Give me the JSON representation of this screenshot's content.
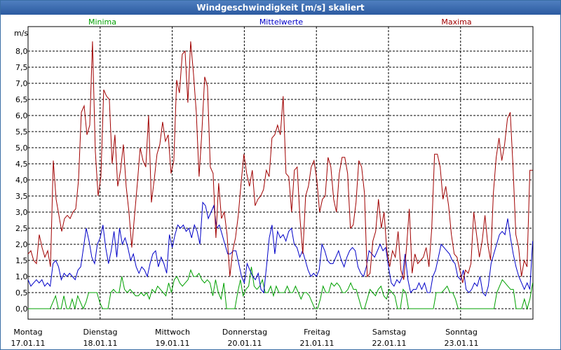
{
  "window": {
    "title": "Windgeschwindigkeit [m/s] skaliert"
  },
  "chart_data": {
    "type": "line",
    "title": "Windgeschwindigkeit [m/s] skaliert",
    "ylabel": "m/s",
    "ylim": [
      0,
      8.6
    ],
    "y_ticks": [
      "0,0",
      "0,5",
      "1,0",
      "1,5",
      "2,0",
      "2,5",
      "3,0",
      "3,5",
      "4,0",
      "4,5",
      "5,0",
      "5,5",
      "6,0",
      "6,5",
      "7,0",
      "7,5",
      "8,0"
    ],
    "y_tick_values": [
      0,
      0.5,
      1,
      1.5,
      2,
      2.5,
      3,
      3.5,
      4,
      4.5,
      5,
      5.5,
      6,
      6.5,
      7,
      7.5,
      8
    ],
    "xlim": [
      0,
      7
    ],
    "x_labels": [
      {
        "day": "Montag",
        "date": "17.01.11",
        "x": 0
      },
      {
        "day": "Dienstag",
        "date": "18.01.11",
        "x": 1
      },
      {
        "day": "Mittwoch",
        "date": "19.01.11",
        "x": 2
      },
      {
        "day": "Donnerstag",
        "date": "20.01.11",
        "x": 3
      },
      {
        "day": "Freitag",
        "date": "21.01.11",
        "x": 4
      },
      {
        "day": "Samstag",
        "date": "22.01.11",
        "x": 5
      },
      {
        "day": "Sonntag",
        "date": "23.01.11",
        "x": 6
      }
    ],
    "grid": true,
    "legend_position": "top",
    "series": [
      {
        "name": "Minima",
        "color": "#00a000",
        "values": [
          0,
          0,
          0,
          0,
          0,
          0,
          0,
          0,
          0,
          0.2,
          0.4,
          0,
          0,
          0.4,
          0,
          0,
          0.3,
          0,
          0.4,
          0.2,
          0,
          0.2,
          0.5,
          0.5,
          0.5,
          0.5,
          0.2,
          0,
          0,
          0,
          0.5,
          0.6,
          0.5,
          0.5,
          1.0,
          0.6,
          0.5,
          0.6,
          0.5,
          0.4,
          0.4,
          0.5,
          0.4,
          0.5,
          0.3,
          0.6,
          0.5,
          0.7,
          0.6,
          0.5,
          0.4,
          0.8,
          0.5,
          0.9,
          1.0,
          0.8,
          0.7,
          0.8,
          0.9,
          1.2,
          1.0,
          1.0,
          1.1,
          0.9,
          0.8,
          0.9,
          0.8,
          0.4,
          0.9,
          0.5,
          0.3,
          0.8,
          0,
          0,
          0,
          0,
          0.5,
          0.9,
          0.4,
          0.6,
          0.7,
          1.3,
          0.7,
          0.6,
          0.7,
          0.9,
          0.5,
          0.5,
          0.7,
          0.4,
          0.7,
          0.5,
          0.5,
          0.5,
          0.7,
          0.5,
          0.5,
          0.7,
          0.5,
          0.3,
          0.5,
          0.5,
          0.4,
          0.2,
          0,
          0,
          0.3,
          0.7,
          0.5,
          0.5,
          0.8,
          0.7,
          0.8,
          0.7,
          0.5,
          0.5,
          0.6,
          0.8,
          0.6,
          0.6,
          0.3,
          0,
          0,
          0.3,
          0.6,
          0.5,
          0.4,
          0.6,
          0.7,
          0.4,
          0.3,
          0.6,
          0.5,
          0.4,
          0,
          0,
          0.6,
          0.5,
          0,
          0,
          0,
          0,
          0,
          0,
          0,
          0,
          0,
          0,
          0.5,
          0.5,
          0.5,
          0.6,
          0.7,
          0.5,
          0.5,
          0.3,
          0,
          0,
          0,
          0,
          0,
          0,
          0,
          0,
          0,
          0,
          0,
          0,
          0,
          0,
          0.5,
          0.7,
          0.9,
          0.8,
          0.7,
          0.6,
          0.6,
          0,
          0,
          0,
          0.3,
          0,
          0.3,
          0.8
        ],
        "x_start": 0.0,
        "x_end": 7.0
      },
      {
        "name": "Mittelwerte",
        "color": "#0000c8",
        "values": [
          0.9,
          0.7,
          0.8,
          0.9,
          0.8,
          0.9,
          0.7,
          0.8,
          0.7,
          1.4,
          1.5,
          1.3,
          0.9,
          1.1,
          1.0,
          1.1,
          1.0,
          0.9,
          1.2,
          1.3,
          1.9,
          2.5,
          2.1,
          1.6,
          1.4,
          2.0,
          2.2,
          2.6,
          1.9,
          1.4,
          1.8,
          2.4,
          1.6,
          2.5,
          2.0,
          2.2,
          1.9,
          1.5,
          1.7,
          1.3,
          1.1,
          1.3,
          1.2,
          1.0,
          1.4,
          1.7,
          1.8,
          1.3,
          1.6,
          1.4,
          1.1,
          2.3,
          1.9,
          2.3,
          2.6,
          2.5,
          2.6,
          2.4,
          2.5,
          2.2,
          2.6,
          2.4,
          2.0,
          3.3,
          3.2,
          2.8,
          3.0,
          3.2,
          2.5,
          2.6,
          2.3,
          2.0,
          1.7,
          1.7,
          1.8,
          1.8,
          1.4,
          1.0,
          0.8,
          1.4,
          1.2,
          1.0,
          0.9,
          1.1,
          0.6,
          0.5,
          1.3,
          2.2,
          2.6,
          1.7,
          2.4,
          2.2,
          2.3,
          2.1,
          2.4,
          2.5,
          2.0,
          1.9,
          1.6,
          1.8,
          1.5,
          1.2,
          1.0,
          1.1,
          1.0,
          1.2,
          2.0,
          1.8,
          1.5,
          1.4,
          1.4,
          1.6,
          1.8,
          1.5,
          1.3,
          1.6,
          1.8,
          1.9,
          1.8,
          1.3,
          1.1,
          1.0,
          1.3,
          1.8,
          1.7,
          1.6,
          1.8,
          2.0,
          1.8,
          1.9,
          1.3,
          0.8,
          0.7,
          0.9,
          0.8,
          1.0,
          1.7,
          0.9,
          0.5,
          0.6,
          0.6,
          0.8,
          0.6,
          0.8,
          0.5,
          0.5,
          1.0,
          1.2,
          1.6,
          2.0,
          1.9,
          1.8,
          1.7,
          1.5,
          1.4,
          1.0,
          0.9,
          1.2,
          0.6,
          0.5,
          0.6,
          0.8,
          0.7,
          1.0,
          0.5,
          0.4,
          0.7,
          1.4,
          1.7,
          2.0,
          2.3,
          2.4,
          2.3,
          2.8,
          2.2,
          1.7,
          1.3,
          1.0,
          0.8,
          0.6,
          0.8,
          0.6,
          2.1
        ],
        "x_start": 0.0,
        "x_end": 7.0
      },
      {
        "name": "Maxima",
        "color": "#a00000",
        "values": [
          1.7,
          1.8,
          1.5,
          1.4,
          2.3,
          1.9,
          1.6,
          1.8,
          1.3,
          4.6,
          3.4,
          2.9,
          2.4,
          2.8,
          2.9,
          2.8,
          3.0,
          3.1,
          4.0,
          6.1,
          6.3,
          5.4,
          5.7,
          8.3,
          4.9,
          3.5,
          4.1,
          6.8,
          6.6,
          6.5,
          4.5,
          5.4,
          3.8,
          4.3,
          5.1,
          3.8,
          3.0,
          1.9,
          2.9,
          3.9,
          5.0,
          4.6,
          4.4,
          6.0,
          3.3,
          4.0,
          4.8,
          5.1,
          5.8,
          5.2,
          5.4,
          4.2,
          4.6,
          7.1,
          6.7,
          7.9,
          8.0,
          6.4,
          8.3,
          7.3,
          6.1,
          4.1,
          5.5,
          7.2,
          6.9,
          4.4,
          4.2,
          2.2,
          3.9,
          2.8,
          3.0,
          2.3,
          1.0,
          1.8,
          2.2,
          2.9,
          3.9,
          4.8,
          4.2,
          3.8,
          4.3,
          3.2,
          3.4,
          3.5,
          3.7,
          4.3,
          4.1,
          5.3,
          5.4,
          5.7,
          5.4,
          6.6,
          4.2,
          4.1,
          3.0,
          4.3,
          4.4,
          2.8,
          1.7,
          3.5,
          3.8,
          4.4,
          4.6,
          4.0,
          3.0,
          3.4,
          3.5,
          4.7,
          4.4,
          3.4,
          3.0,
          4.2,
          4.7,
          4.7,
          4.2,
          2.5,
          2.6,
          3.3,
          4.6,
          4.4,
          3.6,
          1.0,
          1.1,
          2.1,
          2.4,
          3.4,
          2.5,
          3.0,
          1.8,
          1.3,
          1.8,
          1.6,
          2.4,
          1.2,
          0.9,
          1.9,
          3.1,
          1.1,
          1.7,
          1.4,
          1.5,
          1.6,
          1.9,
          1.3,
          2.5,
          4.8,
          4.8,
          4.4,
          3.4,
          3.8,
          3.2,
          2.3,
          1.7,
          1.6,
          1.2,
          0.8,
          1.2,
          1.1,
          1.4,
          3.0,
          2.3,
          1.6,
          2.1,
          2.9,
          2.0,
          1.5,
          3.6,
          4.7,
          5.3,
          4.6,
          5.1,
          5.9,
          6.1,
          4.4,
          2.3,
          1.9,
          1.0,
          1.5,
          1.3,
          4.3,
          4.3
        ],
        "x_start": 0.0,
        "x_end": 7.0
      }
    ]
  }
}
